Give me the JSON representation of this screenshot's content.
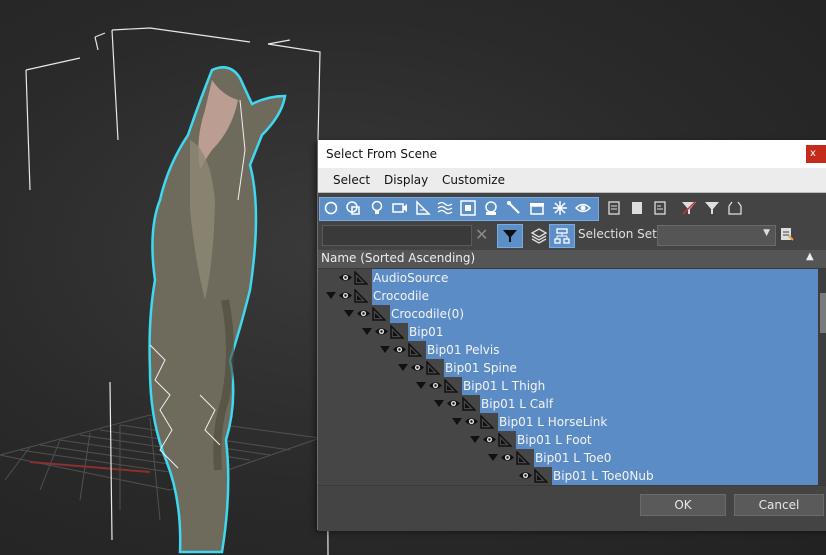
{
  "dialog": {
    "title": "Select From Scene",
    "close_label": "x",
    "menu": [
      "Select",
      "Display",
      "Customize"
    ],
    "toolbar_icons": [
      "geometry-icon",
      "shapes-icon",
      "lights-icon",
      "cameras-icon",
      "helpers-icon",
      "spacewarps-icon",
      "groups-icon",
      "xrefs-icon",
      "bones-icon",
      "containers-icon",
      "frozen-icon",
      "hidden-icon",
      "list-icon",
      "doc-icon",
      "file-icon",
      "filter-funnel-icon",
      "funnel-icon",
      "layer-box-icon"
    ],
    "filter": {
      "search_placeholder": "",
      "clear_label": "✕",
      "selection_set_label": "Selection Set:",
      "selection_set_value": ""
    },
    "column_header": "Name (Sorted Ascending)",
    "sort_indicator": "▲",
    "tree": [
      {
        "label": "AudioSource",
        "depth": 0,
        "expandable": false
      },
      {
        "label": "Crocodile",
        "depth": 0,
        "expandable": true
      },
      {
        "label": "Crocodile(0)",
        "depth": 1,
        "expandable": true
      },
      {
        "label": "Bip01",
        "depth": 2,
        "expandable": true
      },
      {
        "label": "Bip01 Pelvis",
        "depth": 3,
        "expandable": true
      },
      {
        "label": "Bip01 Spine",
        "depth": 4,
        "expandable": true
      },
      {
        "label": "Bip01 L Thigh",
        "depth": 5,
        "expandable": true
      },
      {
        "label": "Bip01 L Calf",
        "depth": 6,
        "expandable": true
      },
      {
        "label": "Bip01 L HorseLink",
        "depth": 7,
        "expandable": true
      },
      {
        "label": "Bip01 L Foot",
        "depth": 8,
        "expandable": true
      },
      {
        "label": "Bip01 L Toe0",
        "depth": 9,
        "expandable": true
      },
      {
        "label": "Bip01 L Toe0Nub",
        "depth": 10,
        "expandable": false
      }
    ],
    "buttons": {
      "ok": "OK",
      "cancel": "Cancel"
    }
  },
  "colors": {
    "selection": "#5b8cc6",
    "panel": "#444444",
    "accent_cyan": "#3fd8f0"
  }
}
